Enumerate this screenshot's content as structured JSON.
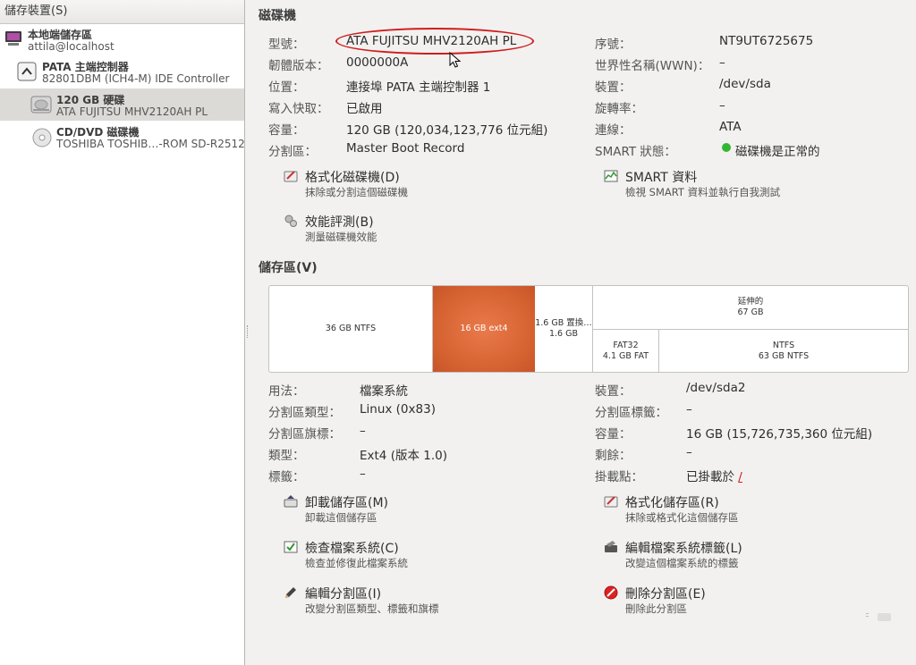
{
  "sidebar": {
    "header": "儲存裝置(S)",
    "items": [
      {
        "title": "本地端儲存區",
        "subtitle": "attila@localhost",
        "icon": "computer-icon"
      },
      {
        "title": "PATA 主端控制器",
        "subtitle": "82801DBM (ICH4-M) IDE Controller",
        "icon": "controller-icon"
      },
      {
        "title": "120 GB 硬碟",
        "subtitle": "ATA FUJITSU MHV2120AH PL",
        "icon": "hard-disk-icon"
      },
      {
        "title": "CD/DVD 磁碟機",
        "subtitle": "TOSHIBA TOSHIB…-ROM SD-R2512",
        "icon": "optical-drive-icon"
      }
    ]
  },
  "drive": {
    "section_title": "磁碟機",
    "left": [
      {
        "label": "型號：",
        "value": "ATA FUJITSU MHV2120AH PL"
      },
      {
        "label": "韌體版本：",
        "value": "0000000A"
      },
      {
        "label": "位置：",
        "value": "連接埠 PATA 主端控制器 1"
      },
      {
        "label": "寫入快取：",
        "value": "已啟用"
      },
      {
        "label": "容量：",
        "value": "120 GB (120,034,123,776 位元組)"
      },
      {
        "label": "分割區：",
        "value": "Master Boot Record"
      }
    ],
    "right": [
      {
        "label": "序號：",
        "value": "NT9UT6725675"
      },
      {
        "label": "世界性名稱(WWN)：",
        "value": "–"
      },
      {
        "label": "裝置：",
        "value": "/dev/sda"
      },
      {
        "label": "旋轉率：",
        "value": "–"
      },
      {
        "label": "連線：",
        "value": "ATA"
      },
      {
        "label": "SMART 狀態：",
        "value": "磁碟機是正常的"
      }
    ],
    "actions": {
      "format": {
        "title": "格式化磁碟機(D)",
        "desc": "抹除或分割這個磁碟機"
      },
      "smart": {
        "title": "SMART 資料",
        "desc": "檢視 SMART 資料並執行自我測試"
      },
      "benchmark": {
        "title": "效能評測(B)",
        "desc": "測量磁碟機效能"
      }
    }
  },
  "volumes": {
    "section_title": "儲存區(V)",
    "partitions": {
      "p1": {
        "line1": "36 GB NTFS",
        "line2": ""
      },
      "p2": {
        "line1": "16 GB ext4",
        "line2": ""
      },
      "p3": {
        "line1": "1.6 GB 置換…",
        "line2": "1.6 GB"
      },
      "ext": {
        "line1": "延伸的",
        "line2": "67 GB"
      },
      "p5": {
        "line1": "FAT32",
        "line2": "4.1 GB FAT"
      },
      "p6": {
        "line1": "NTFS",
        "line2": "63 GB NTFS"
      }
    },
    "left": [
      {
        "label": "用法：",
        "value": "檔案系統"
      },
      {
        "label": "分割區類型：",
        "value": "Linux (0x83)"
      },
      {
        "label": "分割區旗標：",
        "value": "–"
      },
      {
        "label": "類型：",
        "value": "Ext4 (版本 1.0)"
      },
      {
        "label": "標籤：",
        "value": "–"
      }
    ],
    "right": [
      {
        "label": "裝置：",
        "value": "/dev/sda2"
      },
      {
        "label": "分割區標籤：",
        "value": "–"
      },
      {
        "label": "容量：",
        "value": "16 GB (15,726,735,360 位元組)"
      },
      {
        "label": "剩餘：",
        "value": "–"
      },
      {
        "label": "掛載點：",
        "value": "已掛載於",
        "link": "/"
      }
    ],
    "actions": {
      "unmount": {
        "title": "卸載儲存區(M)",
        "desc": "卸載這個儲存區"
      },
      "format": {
        "title": "格式化儲存區(R)",
        "desc": "抹除或格式化這個儲存區"
      },
      "check": {
        "title": "檢查檔案系統(C)",
        "desc": "檢查並修復此檔案系統"
      },
      "edit_label": {
        "title": "編輯檔案系統標籤(L)",
        "desc": "改變這個檔案系統的標籤"
      },
      "edit_partition": {
        "title": "編輯分割區(I)",
        "desc": "改變分割區類型、標籤和旗標"
      },
      "delete": {
        "title": "刪除分割區(E)",
        "desc": "刪除此分割區"
      }
    }
  },
  "colors": {
    "selected_partition": "#d4612f",
    "highlight_ellipse": "#d01c1c",
    "status_ok": "#33b733"
  }
}
